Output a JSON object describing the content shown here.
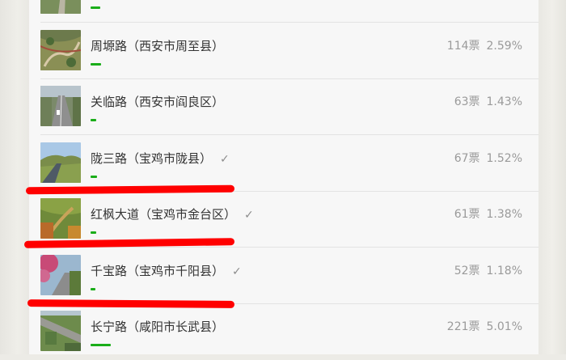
{
  "colors": {
    "accent": "#1aad19",
    "annotation": "#ff0000"
  },
  "items": [
    {
      "name": "……",
      "votes": "",
      "pct": "",
      "share": 0.0241,
      "checked": false
    },
    {
      "name": "周塬路（西安市周至县）",
      "votes": "114票",
      "pct": "2.59%",
      "share": 0.0259,
      "checked": false
    },
    {
      "name": "关临路（西安市阎良区）",
      "votes": "63票",
      "pct": "1.43%",
      "share": 0.0143,
      "checked": false
    },
    {
      "name": "陇三路（宝鸡市陇县）",
      "votes": "67票",
      "pct": "1.52%",
      "share": 0.0152,
      "checked": true
    },
    {
      "name": "红枫大道（宝鸡市金台区）",
      "votes": "61票",
      "pct": "1.38%",
      "share": 0.0138,
      "checked": true
    },
    {
      "name": "千宝路（宝鸡市千阳县）",
      "votes": "52票",
      "pct": "1.18%",
      "share": 0.0118,
      "checked": true
    },
    {
      "name": "长宁路（咸阳市长武县）",
      "votes": "221票",
      "pct": "5.01%",
      "share": 0.0501,
      "checked": false
    }
  ],
  "check_glyph": "✓"
}
